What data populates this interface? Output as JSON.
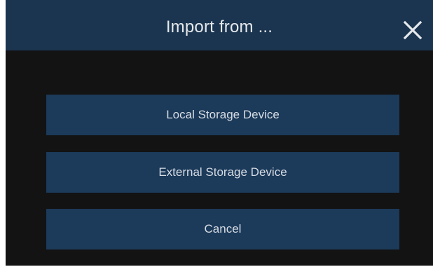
{
  "dialog": {
    "title": "Import from ...",
    "close_icon": "close-icon",
    "buttons": {
      "local": "Local Storage Device",
      "external": "External Storage Device",
      "cancel": "Cancel"
    }
  },
  "colors": {
    "title_bar": "#1b3550",
    "body": "#131313",
    "button": "#1c3a5a",
    "text": "#e6e9ec"
  }
}
